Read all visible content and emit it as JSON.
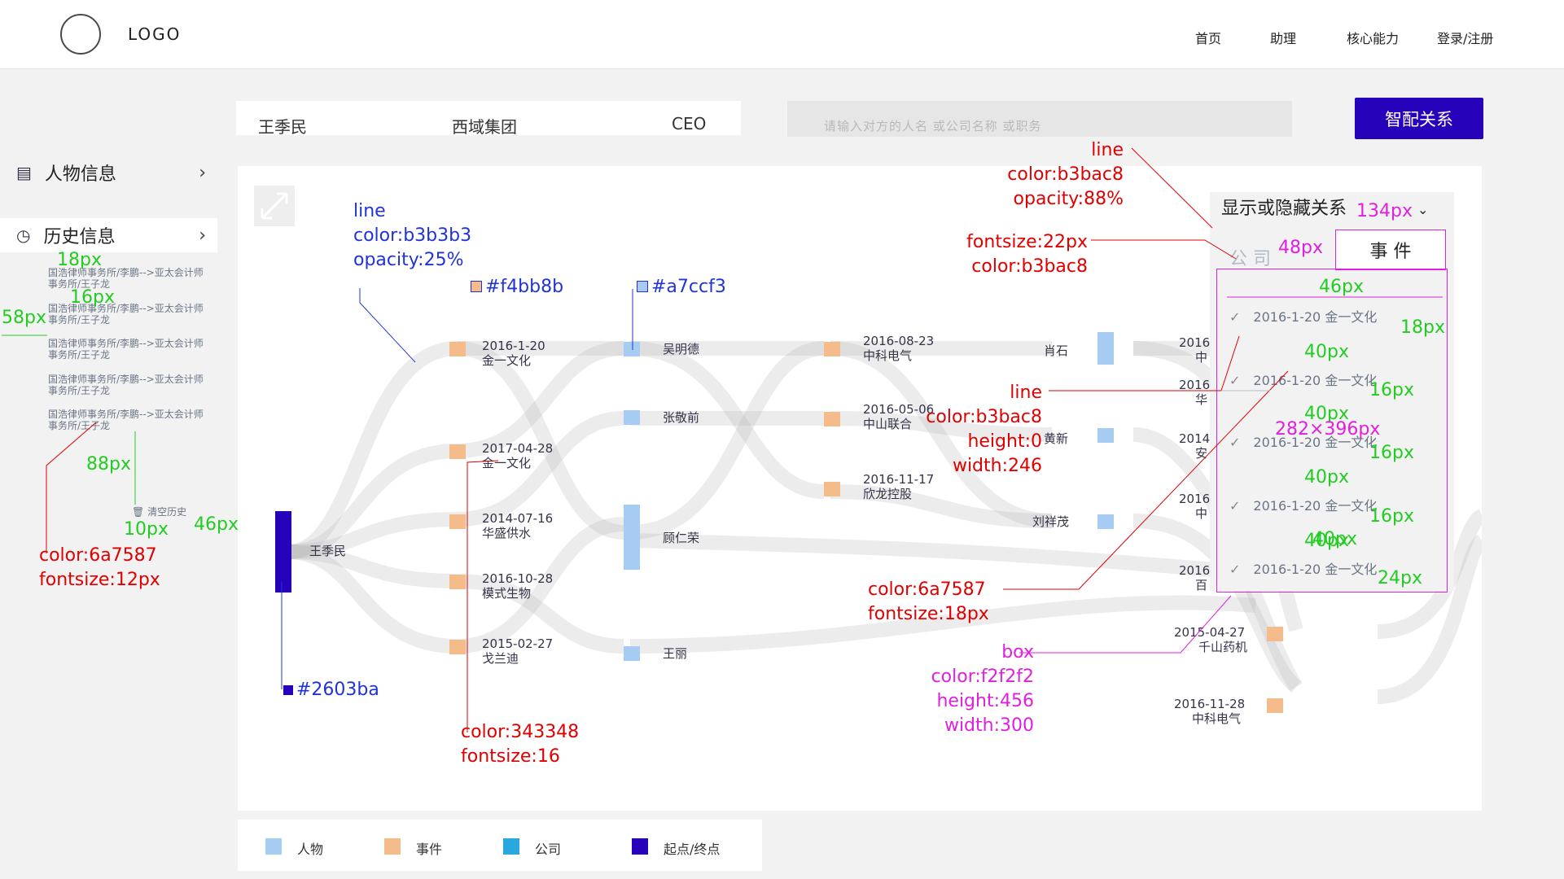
{
  "header": {
    "logo": "LOGO",
    "nav": [
      "首页",
      "助理",
      "核心能力",
      "登录/注册"
    ]
  },
  "profile": {
    "name": "王季民",
    "company": "西域集团",
    "title": "CEO"
  },
  "search": {
    "placeholder": "请输入对方的人名  或公司名称  或职务",
    "button": "智配关系"
  },
  "sidebar": {
    "items": [
      {
        "label": "人物信息",
        "icon": "profile-card-icon"
      },
      {
        "label": "历史信息",
        "icon": "history-clock-icon"
      }
    ],
    "history": [
      "国浩律师事务所/李鹏-->亚太会计师事务所/王子龙",
      "国浩律师事务所/李鹏-->亚太会计师事务所/王子龙",
      "国浩律师事务所/李鹏-->亚太会计师事务所/王子龙",
      "国浩律师事务所/李鹏-->亚太会计师事务所/王子龙",
      "国浩律师事务所/李鹏-->亚太会计师事务所/王子龙"
    ],
    "clear_history": "清空历史"
  },
  "graph": {
    "start": "王季民",
    "events_col1": [
      {
        "date": "2016-1-20",
        "name": "金一文化"
      },
      {
        "date": "2017-04-28",
        "name": "金一文化"
      },
      {
        "date": "2014-07-16",
        "name": "华盛供水"
      },
      {
        "date": "2016-10-28",
        "name": "模式生物"
      },
      {
        "date": "2015-02-27",
        "name": "戈兰迪"
      }
    ],
    "persons_col2": [
      "吴明德",
      "张敬前",
      "顾仁荣",
      "王丽"
    ],
    "events_col3": [
      {
        "date": "2016-08-23",
        "name": "中科电气"
      },
      {
        "date": "2016-05-06",
        "name": "中山联合"
      },
      {
        "date": "2016-11-17",
        "name": "欣龙控股"
      }
    ],
    "persons_col4": [
      "肖石",
      "黄新",
      "刘祥茂"
    ],
    "right_partial": [
      {
        "date": "2016",
        "name": "中"
      },
      {
        "date": "2016",
        "name": "华"
      },
      {
        "date": "2014",
        "name": "安"
      },
      {
        "date": "2016",
        "name": "中"
      },
      {
        "date": "2016",
        "name": "百"
      }
    ],
    "events_col5": [
      {
        "date": "2015-04-27",
        "name": "千山药机"
      },
      {
        "date": "2016-11-28",
        "name": "中科电气"
      }
    ]
  },
  "relation_panel": {
    "dropdown": "显示或隐藏关系",
    "tabs": [
      "公 司",
      "事 件"
    ],
    "rows": [
      {
        "date": "2016-1-20",
        "name": "金一文化",
        "checked": true
      },
      {
        "date": "2016-1-20",
        "name": "金一文化",
        "checked": true
      },
      {
        "date": "2016-1-20",
        "name": "金一文化",
        "checked": true
      },
      {
        "date": "2016-1-20",
        "name": "金一文化",
        "checked": true
      },
      {
        "date": "2016-1-20",
        "name": "金一文化",
        "checked": true
      }
    ]
  },
  "annotations": {
    "line_dropdown": [
      "line",
      "color:b3bac8",
      "opacity:88%"
    ],
    "font_tab": [
      "fontsize:22px",
      "color:b3bac8"
    ],
    "line_sankey": [
      "line",
      "color:b3b3b3",
      "opacity:25%"
    ],
    "swatch_event": "#f4bb8b",
    "swatch_person": "#a7ccf3",
    "swatch_start": "#2603ba",
    "text_spec": [
      "color:343348",
      "fontsize:16"
    ],
    "history_spec": [
      "color:6a7587",
      "fontsize:12px"
    ],
    "line_divider": [
      "line",
      "color:b3bac8",
      "height:0",
      "width:246"
    ],
    "row_spec": [
      "color:6a7587",
      "fontsize:18px"
    ],
    "box_spec": [
      "box",
      "color:f2f2f2",
      "height:456",
      "width:300"
    ],
    "dims_green": [
      "18px",
      "16px",
      "58px",
      "88px",
      "10px",
      "46px",
      "46px",
      "40px",
      "18px",
      "40px",
      "16px",
      "40px",
      "16px",
      "40px",
      "16px",
      "40px",
      "24px"
    ],
    "dims_magenta": [
      "134px",
      "48px",
      "282×396px"
    ]
  },
  "legend": [
    {
      "label": "人物",
      "color": "#a7ccf3"
    },
    {
      "label": "事件",
      "color": "#f4bb8b"
    },
    {
      "label": "公司",
      "color": "#29a8e0"
    },
    {
      "label": "起点/终点",
      "color": "#2603ba"
    }
  ]
}
